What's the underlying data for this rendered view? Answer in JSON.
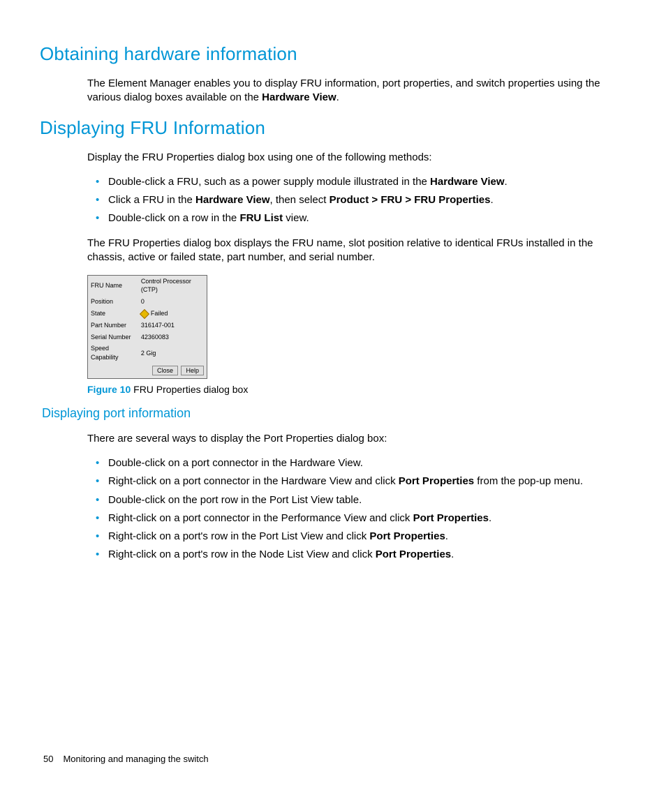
{
  "h1_1": "Obtaining hardware information",
  "p1_a": "The Element Manager enables you to display FRU information, port properties, and switch properties using the various dialog boxes available on the ",
  "p1_b": "Hardware View",
  "p1_c": ".",
  "h1_2": "Displaying FRU Information",
  "p2": "Display the FRU Properties dialog box using one of the following methods:",
  "list1": {
    "i0_a": "Double-click a FRU, such as a power supply module illustrated in the ",
    "i0_b": "Hardware View",
    "i0_c": ".",
    "i1_a": "Click a FRU in the ",
    "i1_b": "Hardware View",
    "i1_c": ", then select ",
    "i1_d": "Product > FRU > FRU Properties",
    "i1_e": ".",
    "i2_a": "Double-click on a row in the ",
    "i2_b": "FRU List",
    "i2_c": " view."
  },
  "p3": "The FRU Properties dialog box displays the FRU name, slot position relative to identical FRUs installed in the chassis, active or failed state, part number, and serial number.",
  "dialog": {
    "labels": {
      "fru_name": "FRU Name",
      "position": "Position",
      "state": "State",
      "part_number": "Part Number",
      "serial_number": "Serial Number",
      "speed_capability": "Speed Capability"
    },
    "values": {
      "fru_name": "Control Processor (CTP)",
      "position": "0",
      "state": "Failed",
      "part_number": "316147-001",
      "serial_number": "42360083",
      "speed_capability": "2 Gig"
    },
    "buttons": {
      "close": "Close",
      "help": "Help"
    }
  },
  "caption": {
    "label": "Figure 10",
    "text": " FRU Properties dialog box"
  },
  "h2_1": "Displaying port information",
  "p4": "There are several ways to display the Port Properties dialog box:",
  "list2": {
    "i0": "Double-click on a port connector in the Hardware View.",
    "i1_a": "Right-click on a port connector in the Hardware View and click ",
    "i1_b": "Port Properties",
    "i1_c": " from the pop-up menu.",
    "i2": "Double-click on the port row in the Port List View table.",
    "i3_a": "Right-click on a port connector in the Performance View and click ",
    "i3_b": "Port Properties",
    "i3_c": ".",
    "i4_a": "Right-click on a port's row in the Port List View and click ",
    "i4_b": "Port Properties",
    "i4_c": ".",
    "i5_a": "Right-click on a port's row in the Node List View and click ",
    "i5_b": "Port Properties",
    "i5_c": "."
  },
  "footer": {
    "page": "50",
    "title": "Monitoring and managing the switch"
  }
}
